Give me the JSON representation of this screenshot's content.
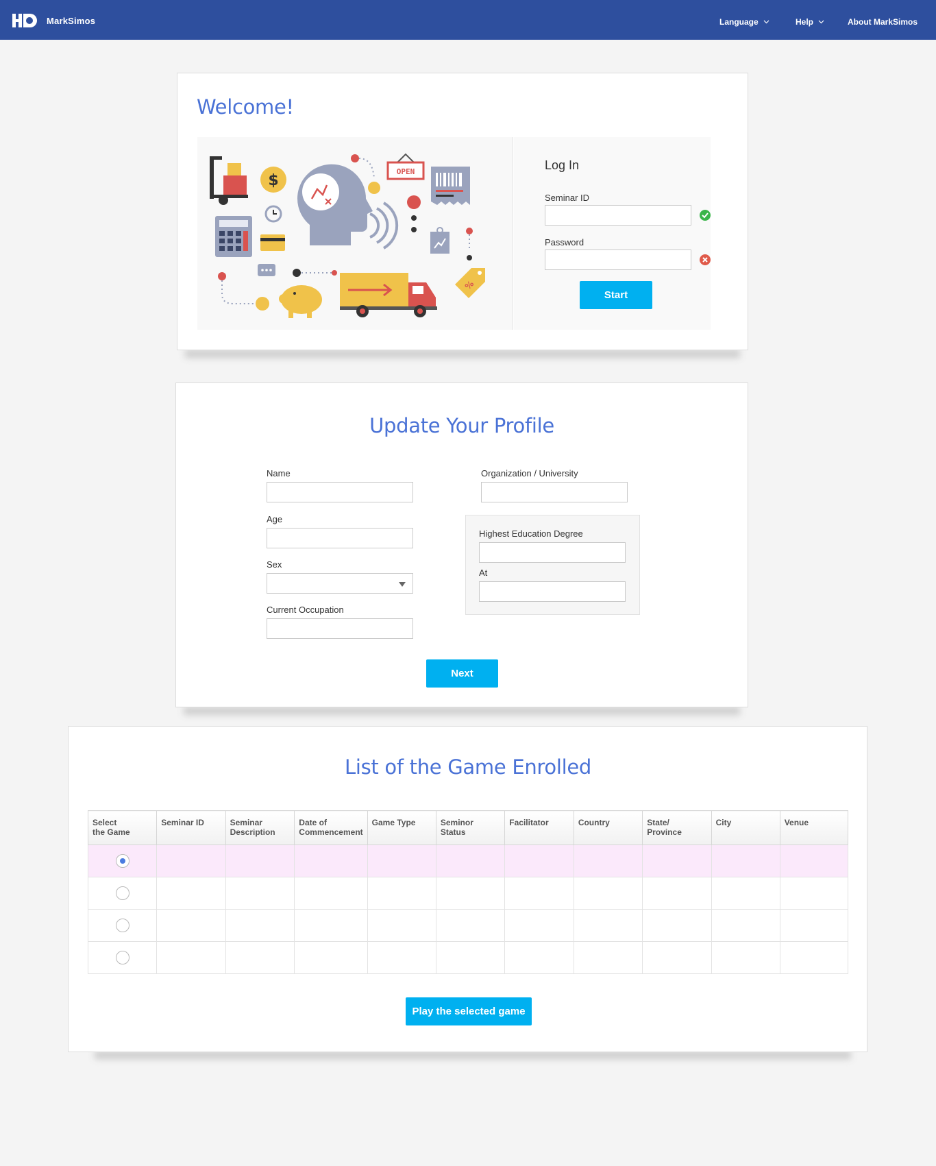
{
  "nav": {
    "brand": "MarkSimos",
    "language": "Language",
    "help": "Help",
    "about": "About MarkSimos"
  },
  "welcome": {
    "title": "Welcome!",
    "illustration_sign": "OPEN",
    "illustration_currency": "$",
    "illustration_tag": "%"
  },
  "login": {
    "title": "Log In",
    "seminar_id_label": "Seminar ID",
    "seminar_id_value": "",
    "seminar_id_status": "valid",
    "password_label": "Password",
    "password_value": "",
    "password_status": "invalid",
    "start_button": "Start"
  },
  "profile": {
    "title": "Update Your Profile",
    "name_label": "Name",
    "age_label": "Age",
    "sex_label": "Sex",
    "sex_value": "",
    "occupation_label": "Current Occupation",
    "organization_label": "Organization / University",
    "education_label": "Highest Education Degree",
    "at_label": "At",
    "next_button": "Next"
  },
  "games": {
    "title": "List of the Game Enrolled",
    "columns": [
      [
        "Select",
        "the Game"
      ],
      [
        "Seminar ID",
        ""
      ],
      [
        "Seminar",
        "Description"
      ],
      [
        "Date of",
        "Commencement"
      ],
      [
        "Game Type",
        ""
      ],
      [
        "Seminor Status",
        ""
      ],
      [
        "Facilitator",
        ""
      ],
      [
        "Country",
        ""
      ],
      [
        "State/",
        "Province"
      ],
      [
        "City",
        ""
      ],
      [
        "Venue",
        ""
      ]
    ],
    "rows": 4,
    "selected_row": 0,
    "play_button": "Play the selected game"
  },
  "colors": {
    "nav_bg": "#2e4f9e",
    "title_blue": "#4a72d6",
    "button_blue": "#00b0f0",
    "valid_green": "#3ab54a",
    "invalid_red": "#e05a4a",
    "selected_row": "#fbe9fb"
  }
}
